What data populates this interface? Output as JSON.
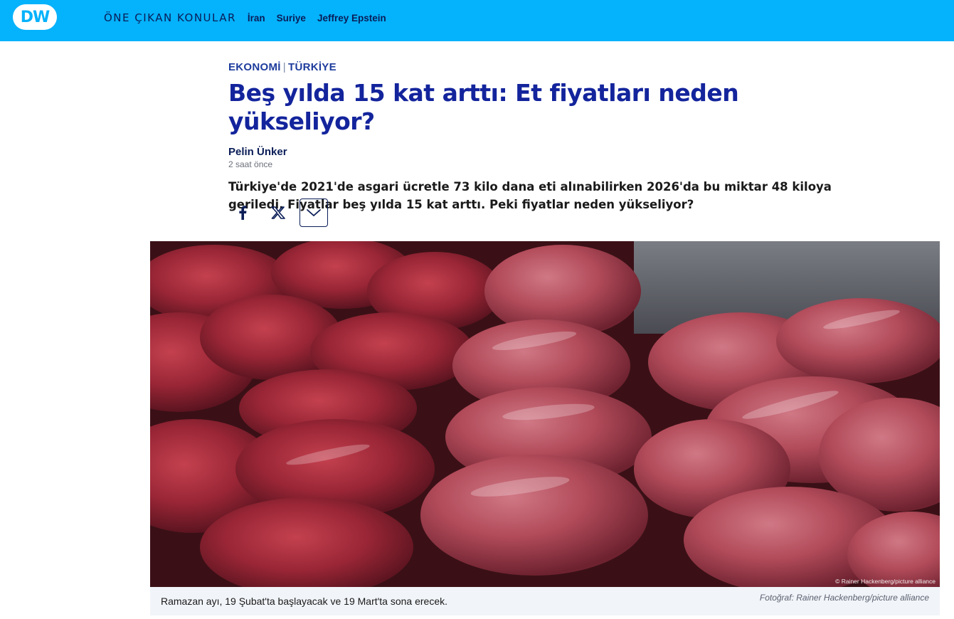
{
  "header": {
    "logo_text": "DW",
    "topics_label": "ÖNE ÇIKAN KONULAR",
    "topics": [
      "İran",
      "Suriye",
      "Jeffrey Epstein"
    ],
    "bg_color": "#05b2fc"
  },
  "article": {
    "category": "EKONOMİ",
    "region": "TÜRKİYE",
    "title": "Beş yılda 15 kat arttı: Et fiyatları neden yükseliyor?",
    "author": "Pelin Ünker",
    "time": "2 saat önce",
    "lead": "Türkiye'de 2021'de asgari ücretle 73 kilo dana eti alınabilirken 2026'da bu miktar 48 kiloya geriledi. Fiyatlar beş yılda 15 kat arttı. Peki fiyatlar neden yükseliyor?"
  },
  "share": {
    "icons": [
      "facebook-icon",
      "x-icon",
      "chevron-down-icon"
    ]
  },
  "image": {
    "overlay_credit": "© Rainer Hackenberg/picture alliance",
    "caption": "Ramazan ayı, 19 Şubat'ta başlayacak ve 19 Mart'ta sona erecek.",
    "photo_credit": "Fotoğraf: Rainer Hackenberg/picture alliance"
  }
}
